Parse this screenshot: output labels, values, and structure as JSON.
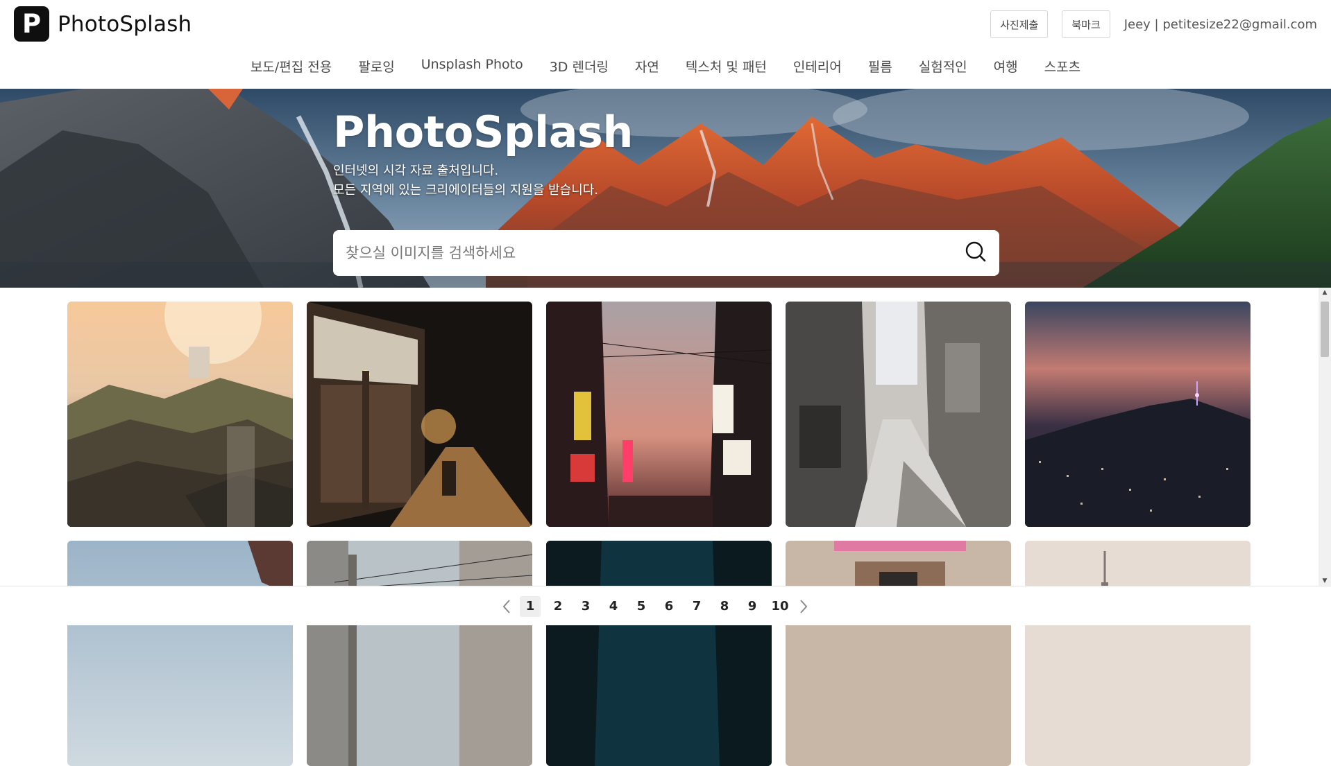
{
  "header": {
    "logo_letter": "P",
    "brand": "PhotoSplash",
    "submit_photo": "사진제출",
    "bookmark": "북마크",
    "user": "Jeey | petitesize22@gmail.com"
  },
  "nav": {
    "items": [
      "보도/편집 전용",
      "팔로잉",
      "Unsplash Photo",
      "3D 렌더링",
      "자연",
      "텍스처 및 패턴",
      "인테리어",
      "필름",
      "실험적인",
      "여행",
      "스포츠"
    ]
  },
  "hero": {
    "title": "PhotoSplash",
    "line1": "인터넷의 시각 자료 출처입니다.",
    "line2": "모든 지역에 있는 크리에이터들의 지원을 받습니다."
  },
  "search": {
    "placeholder": "찾으실 이미지를 검색하세요",
    "icon": "search-icon"
  },
  "photos": [
    "hanok-village-sunset",
    "night-alley-cyclist",
    "neon-street-dusk",
    "narrow-alley-daytime",
    "city-night-tower",
    "sky-building-corner",
    "street-power-lines",
    "teal-night-street",
    "storefront-sign",
    "misty-tower"
  ],
  "pagination": {
    "prev_icon": "chevron-left-icon",
    "next_icon": "chevron-right-icon",
    "pages": [
      "1",
      "2",
      "3",
      "4",
      "5",
      "6",
      "7",
      "8",
      "9",
      "10"
    ],
    "current": "1"
  },
  "colors": {
    "brand_dark": "#0f0f0f",
    "nav_text": "#4a4a4a",
    "active_page_bg": "#eeeeee"
  }
}
